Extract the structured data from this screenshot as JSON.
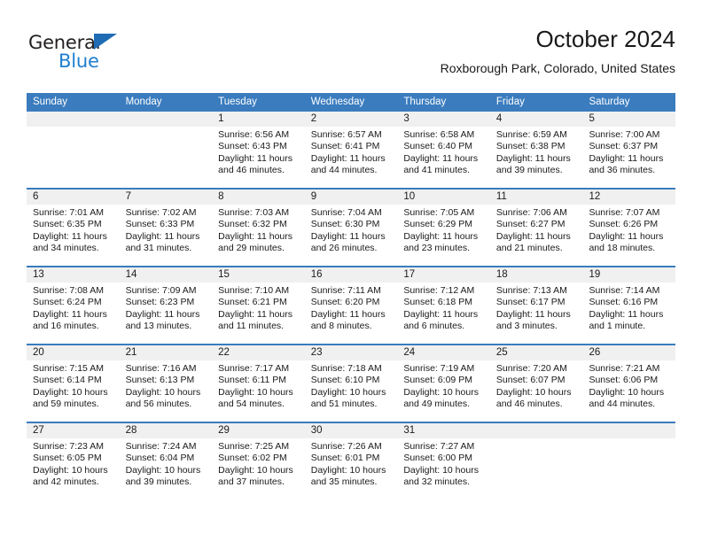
{
  "logo": {
    "word_top": "General",
    "word_bottom": "Blue",
    "triangle_color": "#1f6cb4",
    "blue_color": "#1f7fd0"
  },
  "header": {
    "title": "October 2024",
    "subtitle": "Roxborough Park, Colorado, United States"
  },
  "theme": {
    "header_blue": "#3a7cbe",
    "date_band": "#f0f0f0",
    "text": "#1a1a1a"
  },
  "weekday_headers": [
    "Sunday",
    "Monday",
    "Tuesday",
    "Wednesday",
    "Thursday",
    "Friday",
    "Saturday"
  ],
  "weeks": [
    [
      {
        "date": "",
        "sunrise": "",
        "sunset": "",
        "daylight": "",
        "empty": true
      },
      {
        "date": "",
        "sunrise": "",
        "sunset": "",
        "daylight": "",
        "empty": true
      },
      {
        "date": "1",
        "sunrise": "Sunrise: 6:56 AM",
        "sunset": "Sunset: 6:43 PM",
        "daylight": "Daylight: 11 hours and 46 minutes."
      },
      {
        "date": "2",
        "sunrise": "Sunrise: 6:57 AM",
        "sunset": "Sunset: 6:41 PM",
        "daylight": "Daylight: 11 hours and 44 minutes."
      },
      {
        "date": "3",
        "sunrise": "Sunrise: 6:58 AM",
        "sunset": "Sunset: 6:40 PM",
        "daylight": "Daylight: 11 hours and 41 minutes."
      },
      {
        "date": "4",
        "sunrise": "Sunrise: 6:59 AM",
        "sunset": "Sunset: 6:38 PM",
        "daylight": "Daylight: 11 hours and 39 minutes."
      },
      {
        "date": "5",
        "sunrise": "Sunrise: 7:00 AM",
        "sunset": "Sunset: 6:37 PM",
        "daylight": "Daylight: 11 hours and 36 minutes."
      }
    ],
    [
      {
        "date": "6",
        "sunrise": "Sunrise: 7:01 AM",
        "sunset": "Sunset: 6:35 PM",
        "daylight": "Daylight: 11 hours and 34 minutes."
      },
      {
        "date": "7",
        "sunrise": "Sunrise: 7:02 AM",
        "sunset": "Sunset: 6:33 PM",
        "daylight": "Daylight: 11 hours and 31 minutes."
      },
      {
        "date": "8",
        "sunrise": "Sunrise: 7:03 AM",
        "sunset": "Sunset: 6:32 PM",
        "daylight": "Daylight: 11 hours and 29 minutes."
      },
      {
        "date": "9",
        "sunrise": "Sunrise: 7:04 AM",
        "sunset": "Sunset: 6:30 PM",
        "daylight": "Daylight: 11 hours and 26 minutes."
      },
      {
        "date": "10",
        "sunrise": "Sunrise: 7:05 AM",
        "sunset": "Sunset: 6:29 PM",
        "daylight": "Daylight: 11 hours and 23 minutes."
      },
      {
        "date": "11",
        "sunrise": "Sunrise: 7:06 AM",
        "sunset": "Sunset: 6:27 PM",
        "daylight": "Daylight: 11 hours and 21 minutes."
      },
      {
        "date": "12",
        "sunrise": "Sunrise: 7:07 AM",
        "sunset": "Sunset: 6:26 PM",
        "daylight": "Daylight: 11 hours and 18 minutes."
      }
    ],
    [
      {
        "date": "13",
        "sunrise": "Sunrise: 7:08 AM",
        "sunset": "Sunset: 6:24 PM",
        "daylight": "Daylight: 11 hours and 16 minutes."
      },
      {
        "date": "14",
        "sunrise": "Sunrise: 7:09 AM",
        "sunset": "Sunset: 6:23 PM",
        "daylight": "Daylight: 11 hours and 13 minutes."
      },
      {
        "date": "15",
        "sunrise": "Sunrise: 7:10 AM",
        "sunset": "Sunset: 6:21 PM",
        "daylight": "Daylight: 11 hours and 11 minutes."
      },
      {
        "date": "16",
        "sunrise": "Sunrise: 7:11 AM",
        "sunset": "Sunset: 6:20 PM",
        "daylight": "Daylight: 11 hours and 8 minutes."
      },
      {
        "date": "17",
        "sunrise": "Sunrise: 7:12 AM",
        "sunset": "Sunset: 6:18 PM",
        "daylight": "Daylight: 11 hours and 6 minutes."
      },
      {
        "date": "18",
        "sunrise": "Sunrise: 7:13 AM",
        "sunset": "Sunset: 6:17 PM",
        "daylight": "Daylight: 11 hours and 3 minutes."
      },
      {
        "date": "19",
        "sunrise": "Sunrise: 7:14 AM",
        "sunset": "Sunset: 6:16 PM",
        "daylight": "Daylight: 11 hours and 1 minute."
      }
    ],
    [
      {
        "date": "20",
        "sunrise": "Sunrise: 7:15 AM",
        "sunset": "Sunset: 6:14 PM",
        "daylight": "Daylight: 10 hours and 59 minutes."
      },
      {
        "date": "21",
        "sunrise": "Sunrise: 7:16 AM",
        "sunset": "Sunset: 6:13 PM",
        "daylight": "Daylight: 10 hours and 56 minutes."
      },
      {
        "date": "22",
        "sunrise": "Sunrise: 7:17 AM",
        "sunset": "Sunset: 6:11 PM",
        "daylight": "Daylight: 10 hours and 54 minutes."
      },
      {
        "date": "23",
        "sunrise": "Sunrise: 7:18 AM",
        "sunset": "Sunset: 6:10 PM",
        "daylight": "Daylight: 10 hours and 51 minutes."
      },
      {
        "date": "24",
        "sunrise": "Sunrise: 7:19 AM",
        "sunset": "Sunset: 6:09 PM",
        "daylight": "Daylight: 10 hours and 49 minutes."
      },
      {
        "date": "25",
        "sunrise": "Sunrise: 7:20 AM",
        "sunset": "Sunset: 6:07 PM",
        "daylight": "Daylight: 10 hours and 46 minutes."
      },
      {
        "date": "26",
        "sunrise": "Sunrise: 7:21 AM",
        "sunset": "Sunset: 6:06 PM",
        "daylight": "Daylight: 10 hours and 44 minutes."
      }
    ],
    [
      {
        "date": "27",
        "sunrise": "Sunrise: 7:23 AM",
        "sunset": "Sunset: 6:05 PM",
        "daylight": "Daylight: 10 hours and 42 minutes."
      },
      {
        "date": "28",
        "sunrise": "Sunrise: 7:24 AM",
        "sunset": "Sunset: 6:04 PM",
        "daylight": "Daylight: 10 hours and 39 minutes."
      },
      {
        "date": "29",
        "sunrise": "Sunrise: 7:25 AM",
        "sunset": "Sunset: 6:02 PM",
        "daylight": "Daylight: 10 hours and 37 minutes."
      },
      {
        "date": "30",
        "sunrise": "Sunrise: 7:26 AM",
        "sunset": "Sunset: 6:01 PM",
        "daylight": "Daylight: 10 hours and 35 minutes."
      },
      {
        "date": "31",
        "sunrise": "Sunrise: 7:27 AM",
        "sunset": "Sunset: 6:00 PM",
        "daylight": "Daylight: 10 hours and 32 minutes."
      },
      {
        "date": "",
        "sunrise": "",
        "sunset": "",
        "daylight": "",
        "empty": true
      },
      {
        "date": "",
        "sunrise": "",
        "sunset": "",
        "daylight": "",
        "empty": true
      }
    ]
  ]
}
